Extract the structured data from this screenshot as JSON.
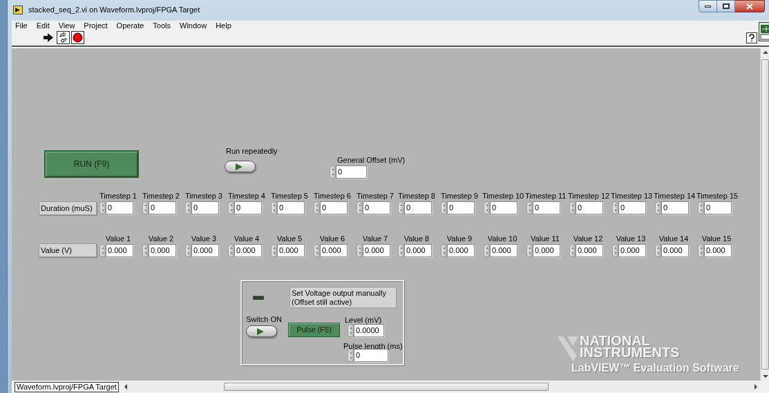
{
  "window": {
    "title": "stacked_seq_2.vi on Waveform.lvproj/FPGA Target"
  },
  "menu": [
    "File",
    "Edit",
    "View",
    "Project",
    "Operate",
    "Tools",
    "Window",
    "Help"
  ],
  "run_button": {
    "label": "RUN (F9)"
  },
  "run_repeatedly": {
    "label": "Run repeatedly",
    "on": false
  },
  "general_offset": {
    "label": "General Offset (mV)",
    "value": "0"
  },
  "duration_row": {
    "label": "Duration (muS)",
    "controls": [
      {
        "label": "Timestep 1",
        "value": "0"
      },
      {
        "label": "Timestep 2",
        "value": "0"
      },
      {
        "label": "Timestep 3",
        "value": "0"
      },
      {
        "label": "Timestep 4",
        "value": "0"
      },
      {
        "label": "Timestep 5",
        "value": "0"
      },
      {
        "label": "Timestep 6",
        "value": "0"
      },
      {
        "label": "Timestep 7",
        "value": "0"
      },
      {
        "label": "Timestep 8",
        "value": "0"
      },
      {
        "label": "Timestep 9",
        "value": "0"
      },
      {
        "label": "Timestep 10",
        "value": "0"
      },
      {
        "label": "Timestep 11",
        "value": "0"
      },
      {
        "label": "Timestep 12",
        "value": "0"
      },
      {
        "label": "Timestep 13",
        "value": "0"
      },
      {
        "label": "Timestep 14",
        "value": "0"
      },
      {
        "label": "Timestep 15",
        "value": "0"
      }
    ]
  },
  "value_row": {
    "label": "Value (V)",
    "controls": [
      {
        "label": "Value 1",
        "value": "0.000"
      },
      {
        "label": "Value 2",
        "value": "0.000"
      },
      {
        "label": "Value 3",
        "value": "0.000"
      },
      {
        "label": "Value 4",
        "value": "0.000"
      },
      {
        "label": "Value 5",
        "value": "0.000"
      },
      {
        "label": "Value 6",
        "value": "0.000"
      },
      {
        "label": "Value 7",
        "value": "0.000"
      },
      {
        "label": "Value 8",
        "value": "0.000"
      },
      {
        "label": "Value 9",
        "value": "0.000"
      },
      {
        "label": "Value 10",
        "value": "0.000"
      },
      {
        "label": "Value 11",
        "value": "0.000"
      },
      {
        "label": "Value 12",
        "value": "0.000"
      },
      {
        "label": "Value 13",
        "value": "0.000"
      },
      {
        "label": "Value 14",
        "value": "0.000"
      },
      {
        "label": "Value 15",
        "value": "0.000"
      }
    ]
  },
  "manual_panel": {
    "led": {
      "on": false
    },
    "description": [
      "Set Voltage output manually",
      "(Offset still active)"
    ],
    "switch": {
      "label": "Switch ON",
      "on": false
    },
    "pulse_button": {
      "label": "Pulse (F5)"
    },
    "level": {
      "label": "Level  (mV)",
      "value": "0.0000"
    },
    "pulse_length": {
      "label": "Pulse length (ms)",
      "value": "0"
    }
  },
  "watermark": {
    "brand": [
      "NATIONAL",
      "INSTRUMENTS"
    ],
    "product": "LabVIEW™ Evaluation Software"
  },
  "status_bar": {
    "project": "Waveform.lvproj/FPGA Target"
  }
}
